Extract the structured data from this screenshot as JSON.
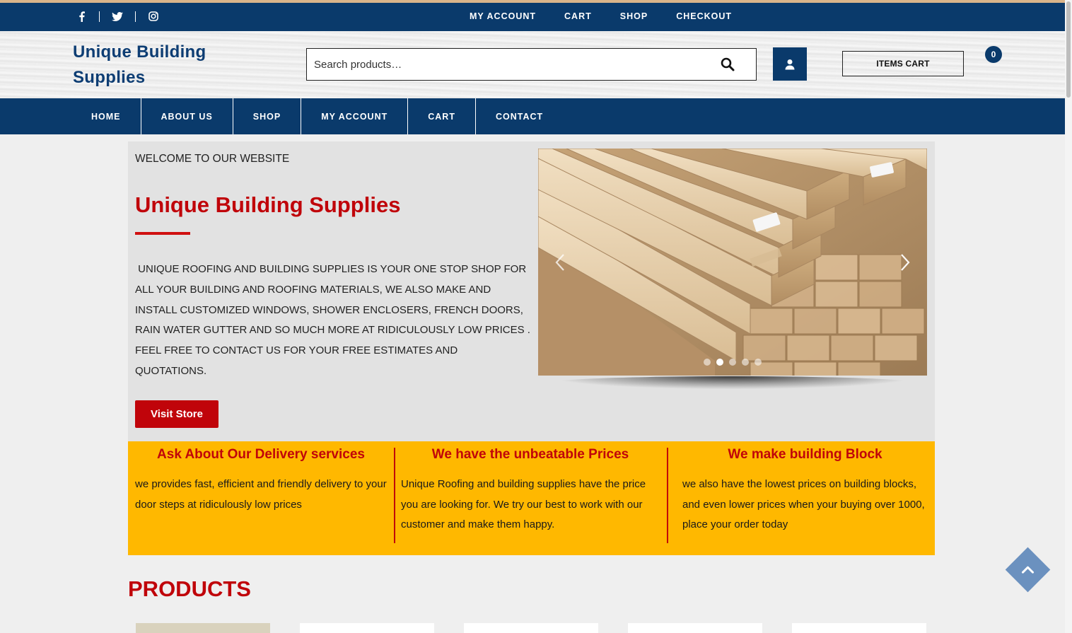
{
  "social": {
    "icons": [
      "facebook-icon",
      "twitter-icon",
      "instagram-icon"
    ]
  },
  "topnav": [
    "MY ACCOUNT",
    "CART",
    "SHOP",
    "CHECKOUT"
  ],
  "header": {
    "logo": "Unique Building Supplies",
    "search_placeholder": "Search products…",
    "cart_label": "ITEMS CART",
    "cart_count": "0"
  },
  "mainnav": [
    "HOME",
    "ABOUT US",
    "SHOP",
    "MY ACCOUNT",
    "CART",
    "CONTACT"
  ],
  "hero": {
    "welcome": "WELCOME TO OUR WEBSITE",
    "title": "Unique Building Supplies",
    "text": " UNIQUE ROOFING AND BUILDING SUPPLIES IS YOUR ONE STOP SHOP FOR ALL YOUR BUILDING AND ROOFING MATERIALS, WE ALSO MAKE AND INSTALL CUSTOMIZED WINDOWS, SHOWER ENCLOSERS, FRENCH DOORS, RAIN WATER GUTTER AND SO MUCH MORE AT RIDICULOUSLY LOW PRICES . FEEL FREE TO CONTACT US FOR YOUR FREE ESTIMATES AND QUOTATIONS.",
    "button": "Visit Store"
  },
  "slider": {
    "slide_count": 5,
    "active_slide": 2
  },
  "features": [
    {
      "title": "Ask About Our Delivery services",
      "text": "we provides fast, efficient and friendly delivery to your door steps at ridiculously low prices"
    },
    {
      "title": "We have the unbeatable Prices",
      "text": "Unique Roofing and building supplies have the price you are looking for. We try our best to work with our customer and make them happy."
    },
    {
      "title": "We make building Block",
      "text": "we also have the lowest prices on building blocks, and even lower prices when your buying over 1000, place your order today"
    }
  ],
  "products": {
    "title": "PRODUCTS"
  },
  "colors": {
    "navy": "#0a3a6b",
    "red": "#c0040a",
    "yellow": "#ffb800"
  }
}
